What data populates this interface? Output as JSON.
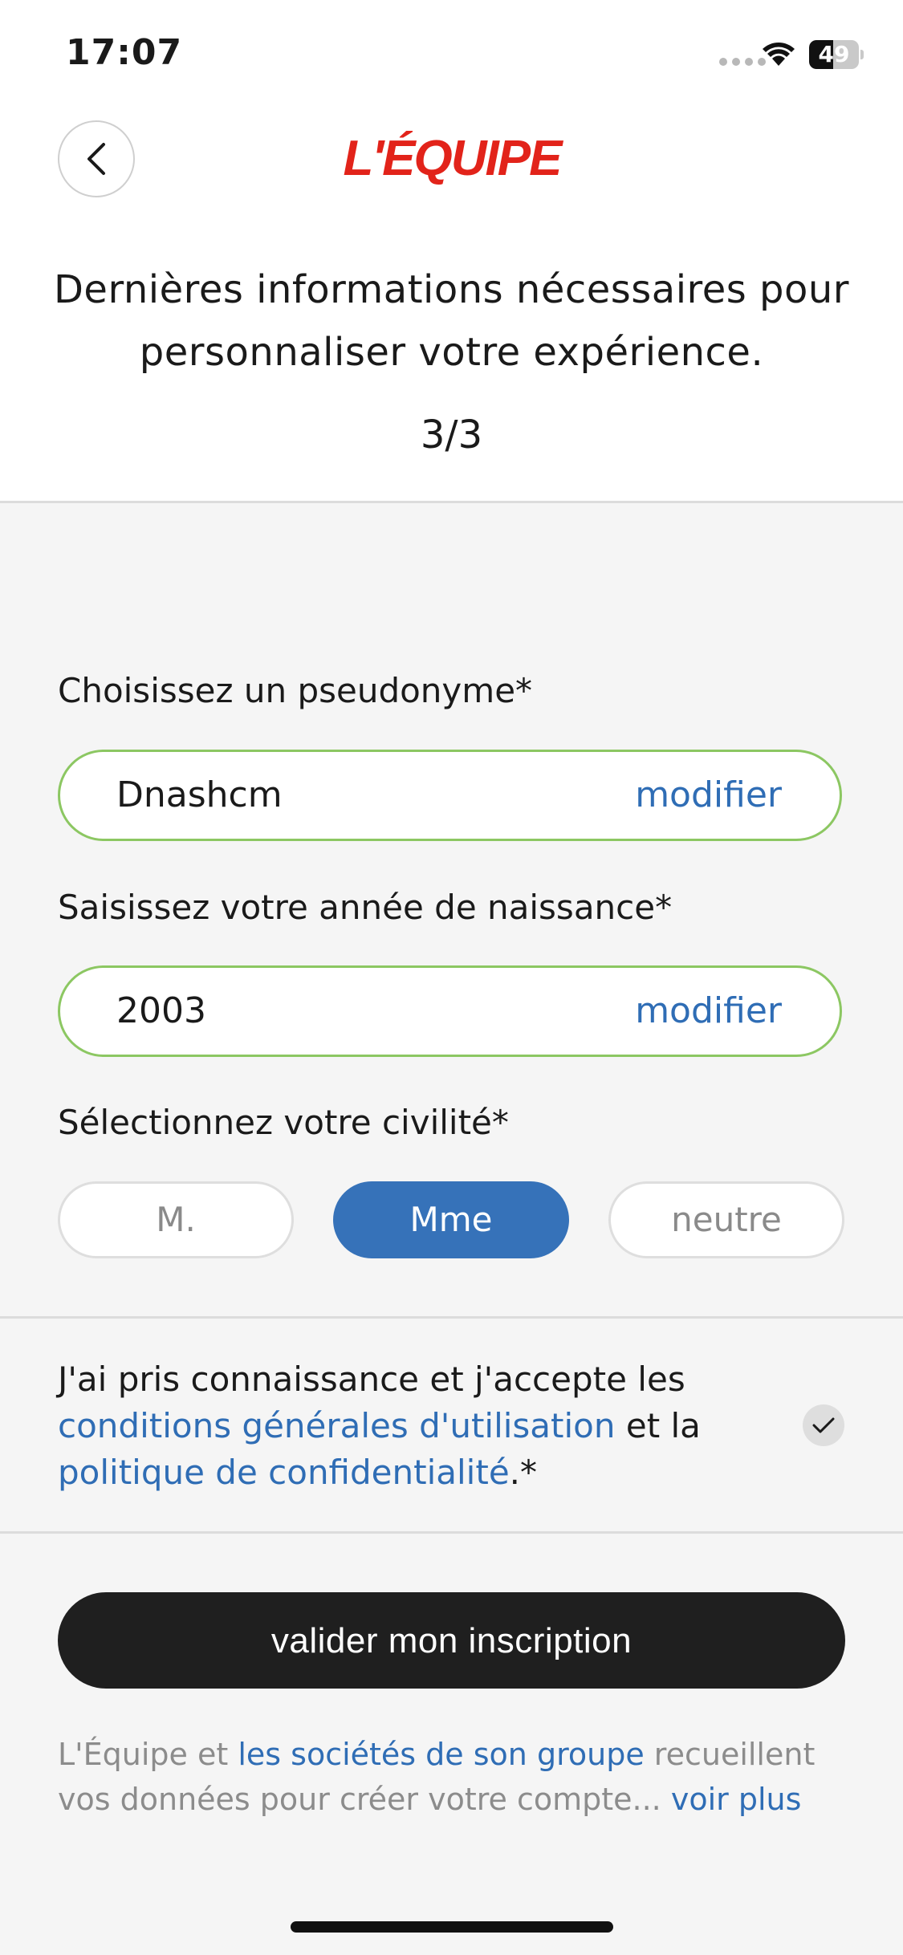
{
  "status_bar": {
    "time": "17:07",
    "battery": "49",
    "battery_level": 0.49
  },
  "header": {
    "back_icon": "chevron-left-icon",
    "logo_text": "L'ÉQUIPE",
    "logo_color": "#e2231a",
    "headline": "Dernières informations nécessaires pour personnaliser votre expérience.",
    "step": "3/3"
  },
  "form": {
    "pseudonym": {
      "label": "Choisissez un pseudonyme*",
      "value": "Dnashcm",
      "action": "modifier"
    },
    "birth_year": {
      "label": "Saisissez votre année de naissance*",
      "value": "2003",
      "action": "modifier"
    },
    "civility": {
      "label": "Sélectionnez votre civilité*",
      "options": [
        "M.",
        "Mme",
        "neutre"
      ],
      "selected": "Mme"
    }
  },
  "consent": {
    "text_1": "J'ai pris connaissance et j'accepte les ",
    "link_1": "conditions générales d'utilisation",
    "text_2": " et la ",
    "link_2": "politique de confidentialité",
    "text_3": ".*",
    "checked": true
  },
  "submit_label": "valider mon inscription",
  "footer": {
    "text_1": "L'Équipe et ",
    "link_1": "les sociétés de son groupe",
    "text_2": " recueillent vos données pour créer votre compte... ",
    "link_2": "voir plus"
  },
  "colors": {
    "accent_blue": "#2f6db5",
    "selected_pill": "#3672b9",
    "valid_border": "#8cc762",
    "button_dark": "#1f1f1f"
  }
}
